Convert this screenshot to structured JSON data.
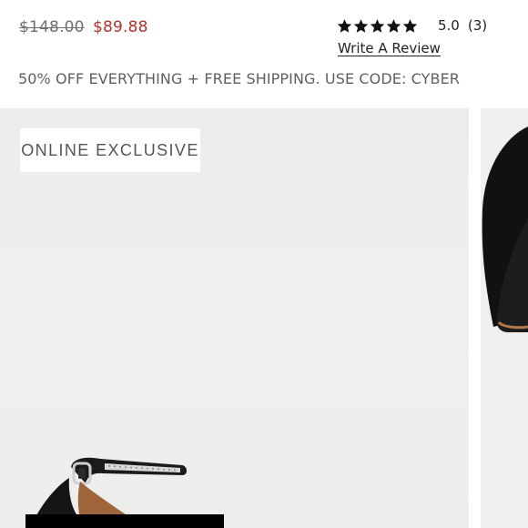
{
  "product": {
    "price_original": "$148.00",
    "price_sale": "$89.88",
    "sale_color": "#b3322e"
  },
  "rating": {
    "stars": 5,
    "score": "5.0",
    "count": "(3)",
    "write_review": "Write A Review"
  },
  "promo": {
    "text": "50% OFF EVERYTHING + FREE SHIPPING. USE CODE: CYBER"
  },
  "gallery": {
    "badge": "ONLINE EXCLUSIVE",
    "images": [
      {
        "name": "black-suede-ankle-strap-heel",
        "icon": "shoe-image"
      },
      {
        "name": "black-suede-heel-alternate-view",
        "icon": "shoe-image"
      }
    ]
  }
}
